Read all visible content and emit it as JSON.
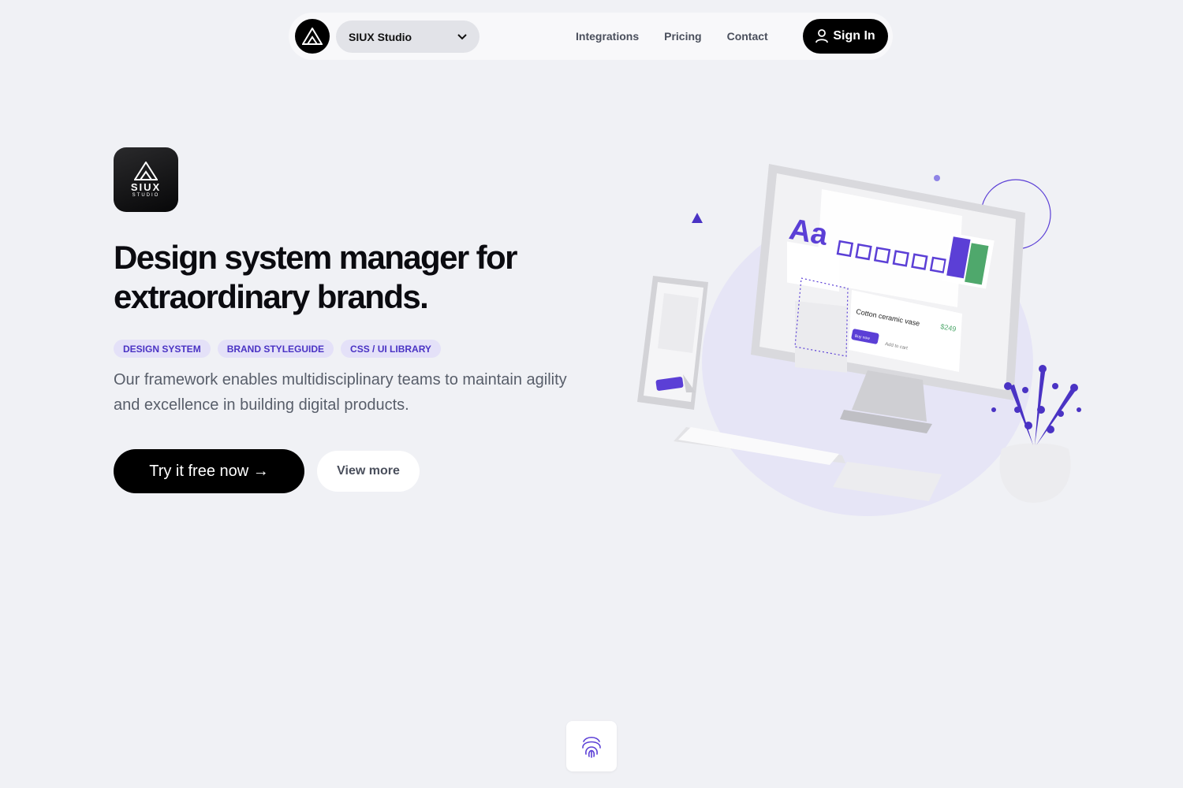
{
  "nav": {
    "logo_icon": "siux-mountain-logo",
    "select_label": "SIUX Studio",
    "links": [
      "Integrations",
      "Pricing",
      "Contact"
    ],
    "signin_label": "Sign In",
    "signin_icon": "user-icon"
  },
  "hero": {
    "app_icon": {
      "word": "SIUX",
      "sub": "STUDIO"
    },
    "headline": "Design system manager for extraordinary brands.",
    "tags": [
      "DESIGN SYSTEM",
      "BRAND STYLEGUIDE",
      "CSS / UI LIBRARY"
    ],
    "description": "Our framework enables multidisciplinary teams to maintain agility and excellence in building digital products.",
    "cta_primary": "Try it free now →",
    "cta_secondary": "View more"
  },
  "illustration": {
    "typeface_sample": "Aa",
    "product_name": "Cotton ceramic vase",
    "product_price": "$249",
    "buy_label": "Buy now",
    "cart_label": "Add to cart"
  },
  "footer": {
    "fingerprint_icon": "fingerprint-icon"
  },
  "colors": {
    "accent": "#5b3fd6",
    "accent_light": "#e4e1f8",
    "background": "#f0f1f5",
    "dark": "#000000"
  }
}
